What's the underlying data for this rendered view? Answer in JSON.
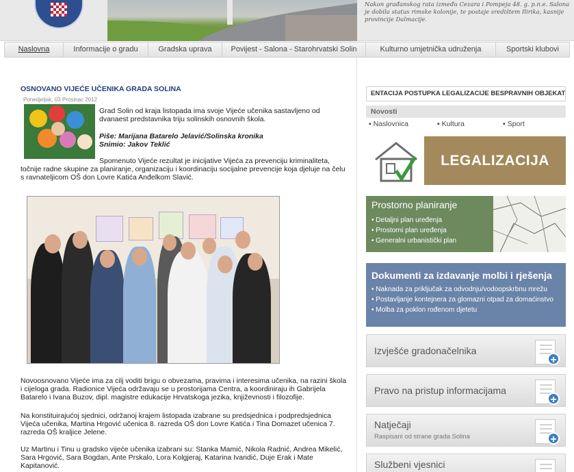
{
  "header": {
    "blurb": "Nakon građanskog rata između Cezara i Pompeja 48. g. p.n.e. Salona je dobila status rimske kolonije, te postaje središtem Ilirika, kasnije provincije Dalmacije."
  },
  "nav": {
    "items": [
      {
        "label": "Naslovna"
      },
      {
        "label": "Informacije o gradu"
      },
      {
        "label": "Gradska uprava"
      },
      {
        "label": "Povijest - Salona - Starohrvatski Solin"
      },
      {
        "label": "Kulturno umjetnička udruženja"
      },
      {
        "label": "Sportski klubovi"
      }
    ]
  },
  "article": {
    "title": "OSNOVANO VIJEĆE UČENIKA GRADA SOLINA",
    "date": "Ponedjeljak, 03 Prosinac 2012",
    "intro": "Grad Solin od kraja listopada ima svoje Vijeće učenika sastavljeno od dvanaest predstavnika triju solinskih osnovnih škola.",
    "byline_author": "Piše: Marijana Batarelo Jelavić/Solinska kronika",
    "byline_photo": "Snimio: Jakov Teklić",
    "para1": "Spomenuto Vijeće rezultat je inicijative Vijeća za prevenciju kriminaliteta, točnije radne skupine za planiranje, organizaciju i koordinaciju socijalne prevencije koja djeluje na čelu s ravnateljicom OŠ don Lovre Katića Anđelkom Slavić.",
    "para2": "Novoosnovano Vijeće ima za cilj voditi brigu o obvezama, pravima i interesima učenika, na razini škola i cijeloga grada. Radionice Vijeća održavaju se u prostorijama Centra, a koordiniraju ih Gabrijela Batarelo i Ivana Buzov, dipl. magistre edukacije Hrvatskoga jezika, književnosti i filozofije.",
    "para3": "Na konstituirajućoj sjednici, održanoj krajem listopada izabrane su predsjednica i podpredsjednica Vijeća učenika, Martina Hrgović učenica 8. razreda OŠ don Lovre Katića i Tina Domazet učenica 7. razreda OŠ kraljice Jelene.",
    "para4": "Uz Martinu i Tinu u gradsko vijeće učenika izabrani su: Stanka Mamić, Nikola Radnić, Andrea Mikelić, Sara Hrgović, Sara Bogdan, Ante Prskalo, Lora Kolgjeraj, Katarina Ivandić, Duje Erak i Mate Kapitanović."
  },
  "sidebar": {
    "legal_link": "ENTACIJA POSTUPKA LEGALIZACIJE BESPRAVNIH OBJEKAT",
    "news_heading": "Novosti",
    "news_tabs": [
      "Naslovnica",
      "Kultura",
      "Sport"
    ],
    "legal_banner": "LEGALIZACIJA",
    "planning": {
      "title": "Prostorno planiranje",
      "items": [
        "Detaljni plan uređenja",
        "Prostorni plan uređenja",
        "Generalni urbanistički plan"
      ]
    },
    "documents": {
      "title": "Dokumenti za izdavanje molbi i rješenja",
      "items": [
        "Naknada za priključak za odvodnju/vodoopskrbnu mrežu",
        "Postavljanje kontejnera za glomazni otpad za domaćinstvo",
        "Molba za poklon rođenom djetetu"
      ]
    },
    "cards": [
      {
        "title": "Izvješće gradonačelnika",
        "subtitle": ""
      },
      {
        "title": "Pravo na pristup informacijama",
        "subtitle": ""
      },
      {
        "title": "Natječaji",
        "subtitle": "Raspisani od strane grada Solina"
      },
      {
        "title": "Službeni vjesnici",
        "subtitle": ""
      }
    ]
  },
  "colors": {
    "nav_bg": "#e3e3e3",
    "title_blue": "#1f3e7a",
    "legal_brown": "#a3895b",
    "planning_green": "#6d8a5f",
    "documents_blue": "#6a83a8"
  }
}
